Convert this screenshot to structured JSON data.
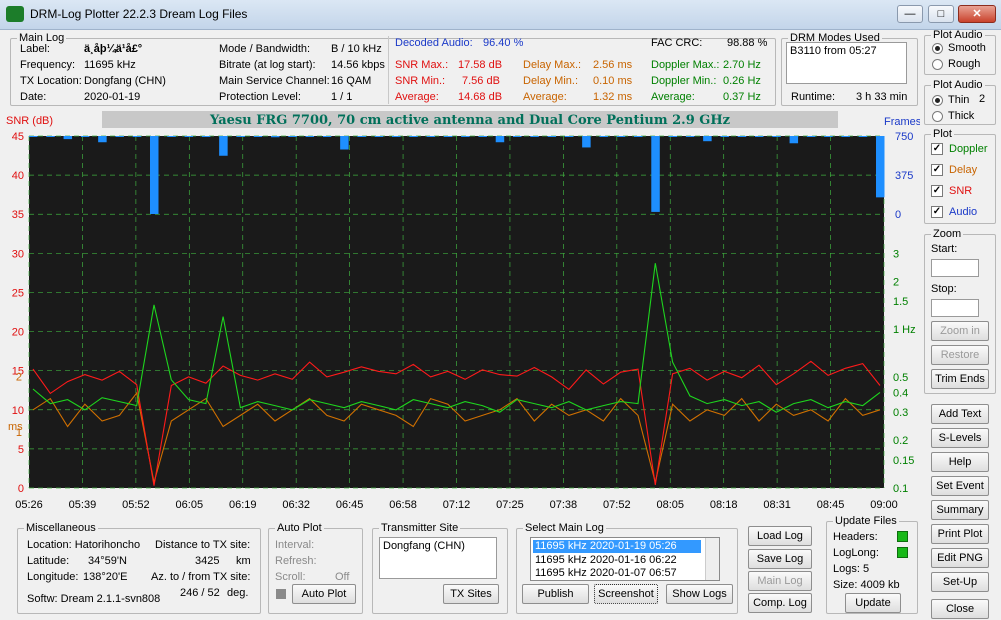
{
  "window": {
    "title": "DRM-Log Plotter 22.2.3    Dream Log Files",
    "min": "—",
    "max": "□",
    "close": "✕"
  },
  "mainlog": {
    "legend": "Main Log",
    "label_k": "Label:",
    "label_v": "ä¸­åþ¼ä¹å£°",
    "freq_k": "Frequency:",
    "freq_v": "11695   kHz",
    "tx_k": "TX Location:",
    "tx_v": "Dongfang (CHN)",
    "date_k": "Date:",
    "date_v": "2020-01-19",
    "mode_k": "Mode / Bandwidth:",
    "mode_v": "B / 10 kHz",
    "bitrate_k": "Bitrate (at log start):",
    "bitrate_v": "14.56 kbps",
    "msc_k": "Main Service Channel:",
    "msc_v": "16  QAM",
    "prot_k": "Protection Level:",
    "prot_v": "1 / 1"
  },
  "stats": {
    "decoded_k": "Decoded Audio:",
    "decoded_v": "96.40 %",
    "fac_k": "FAC  CRC:",
    "fac_v": "98.88 %",
    "snrmax_k": "SNR Max.:",
    "snrmax_v": "17.58  dB",
    "snrmin_k": "SNR Min.:",
    "snrmin_v": "7.56  dB",
    "snravg_k": "Average:",
    "snravg_v": "14.68  dB",
    "dmax_k": "Delay Max.:",
    "dmax_v": "2.56    ms",
    "dmin_k": "Delay Min.:",
    "dmin_v": "0.10    ms",
    "davg_k": "Average:",
    "davg_v": "1.32    ms",
    "dopmax_k": "Doppler Max.:",
    "dopmax_v": "2.70 Hz",
    "dopmin_k": "Doppler Min.:",
    "dopmin_v": "0.26 Hz",
    "dopavg_k": "Average:",
    "dopavg_v": "0.37 Hz"
  },
  "drmmodes": {
    "legend": "DRM Modes Used",
    "entry": "B3110 from 05:27",
    "runtime_k": "Runtime:",
    "runtime_v": "3 h 33 min"
  },
  "plot_audio": {
    "legend": "Plot Audio",
    "smooth": "Smooth",
    "rough": "Rough"
  },
  "plot_audio2": {
    "legend": "Plot Audio",
    "thin": "Thin",
    "thick": "Thick",
    "value": "2"
  },
  "plot_opts": {
    "legend": "Plot",
    "doppler": "Doppler",
    "delay": "Delay",
    "snr": "SNR",
    "audio": "Audio",
    "check": "✓"
  },
  "zoom": {
    "legend": "Zoom",
    "start": "Start:",
    "stop": "Stop:",
    "zoomin": "Zoom in",
    "restore": "Restore",
    "trim": "Trim Ends"
  },
  "rightbtns": {
    "addtext": "Add Text",
    "slevels": "S-Levels",
    "help": "Help",
    "setevent": "Set Event",
    "summary": "Summary",
    "printplot": "Print Plot",
    "editpng": "Edit PNG",
    "setup": "Set-Up",
    "close": "Close"
  },
  "misc": {
    "legend": "Miscellaneous",
    "loc": "Location: Hatorihoncho",
    "dist_k": "Distance to TX site:",
    "lat_k": "Latitude:",
    "lat_v": "34°59'N",
    "dist_v": "3425",
    "lon_k": "Longitude:",
    "lon_v": "138°20'E",
    "km": "km",
    "az_k": "Az. to / from TX site:",
    "az_v": "246 / 52",
    "deg": "deg.",
    "softw": "Softw: Dream 2.1.1-svn808"
  },
  "autoplot": {
    "legend": "Auto Plot",
    "interval": "Interval:",
    "refresh": "Refresh:",
    "scroll": "Scroll:",
    "scroll_v": "Off",
    "btn": "Auto Plot"
  },
  "txsite": {
    "legend": "Transmitter Site",
    "entry": "Dongfang (CHN)",
    "btn": "TX Sites"
  },
  "selectlog": {
    "legend": "Select Main Log",
    "rows": [
      "11695 kHz  2020-01-19   05:26",
      "11695 kHz  2020-01-16   06:22",
      "11695 kHz  2020-01-07   06:57"
    ],
    "publish": "Publish",
    "screenshot": "Screenshot",
    "showlogs": "Show Logs"
  },
  "logbtns": {
    "load": "Load Log",
    "save": "Save Log",
    "main": "Main Log",
    "comp": "Comp. Log"
  },
  "update": {
    "legend": "Update Files",
    "headers": "Headers:",
    "loglong": "LogLong:",
    "logs": "Logs: 5",
    "size": "Size:   4009 kb",
    "btn": "Update"
  },
  "chart_data": {
    "type": "line",
    "title": "Yaesu FRG 7700, 70 cm active antenna and Dual Core Pentium 2.9 GHz",
    "left_axis_label": "SNR (dB)",
    "left_ticks": [
      "45",
      "40",
      "35",
      "30",
      "25",
      "20",
      "15",
      "10",
      "5",
      "0"
    ],
    "delay_axis_label": "ms",
    "delay_ticks": [
      "2",
      "1"
    ],
    "right_axis_label": "Frames",
    "frames_ticks": [
      "750",
      "375",
      "0"
    ],
    "doppler_ticks": [
      "3",
      "2",
      "1.5",
      "1 Hz",
      "0.5",
      "0.4",
      "0.3",
      "0.2",
      "0.15",
      "0.1"
    ],
    "x_ticks": [
      "05:26",
      "05:39",
      "05:52",
      "06:05",
      "06:19",
      "06:32",
      "06:45",
      "06:58",
      "07:12",
      "07:25",
      "07:38",
      "07:52",
      "08:05",
      "08:18",
      "08:31",
      "08:45",
      "09:00"
    ],
    "ylim": [
      0,
      45
    ],
    "grid": true,
    "colors": {
      "snr": "#ff1a1a",
      "delay": "#d07000",
      "doppler": "#1ed51e",
      "audio": "#1e8fff",
      "grid": "#3fae3f",
      "bg": "#1a1a1a"
    },
    "series": [
      {
        "name": "SNR",
        "y": [
          15.2,
          12.1,
          13.6,
          14.5,
          13.8,
          14.9,
          13.2,
          0.3,
          13.1,
          14.2,
          13.4,
          15.6,
          14.4,
          13.8,
          14.6,
          13.9,
          16.1,
          14.2,
          14.8,
          15.5,
          14.9,
          14.6,
          15.8,
          14.2,
          14.9,
          13.9,
          15.1,
          14.5,
          14.3,
          15.4,
          14.2,
          12.6,
          15.1,
          13.3,
          14.8,
          15.2,
          0.4,
          14.6,
          15.3,
          13.8,
          14.9,
          14.1,
          15.7,
          13.2,
          14.6,
          16.2,
          14.4,
          15.3,
          15.9,
          13.1
        ]
      },
      {
        "name": "Delay",
        "y": [
          1.4,
          1.6,
          1.1,
          1.5,
          1.2,
          1.3,
          1.7,
          0.1,
          1.2,
          1.4,
          1.6,
          1.1,
          1.3,
          1.5,
          1.2,
          1.4,
          1.6,
          1.3,
          1.2,
          1.5,
          1.4,
          1.3,
          1.1,
          1.6,
          1.5,
          1.2,
          1.3,
          1.4,
          1.6,
          1.2,
          1.5,
          1.3,
          1.4,
          1.2,
          1.6,
          1.3,
          0.1,
          1.5,
          1.2,
          1.4,
          1.3,
          1.6,
          1.2,
          1.5,
          1.3,
          1.4,
          1.2,
          1.6,
          1.3,
          1.4
        ]
      },
      {
        "name": "Doppler",
        "y": [
          0.42,
          0.34,
          0.36,
          0.31,
          0.37,
          0.35,
          0.33,
          1.42,
          0.48,
          0.36,
          0.34,
          1.2,
          0.32,
          0.35,
          0.33,
          0.31,
          0.36,
          0.34,
          0.32,
          0.35,
          0.33,
          0.31,
          0.36,
          0.34,
          0.32,
          0.35,
          0.33,
          0.3,
          0.36,
          0.34,
          0.32,
          0.35,
          0.31,
          0.33,
          0.35,
          0.34,
          2.6,
          0.62,
          0.38,
          0.34,
          0.36,
          0.33,
          0.35,
          0.3,
          0.34,
          0.36,
          0.32,
          0.35,
          0.33,
          0.4
        ]
      },
      {
        "name": "Audio",
        "y": [
          748,
          745,
          720,
          748,
          690,
          748,
          746,
          0,
          748,
          744,
          748,
          560,
          748,
          748,
          738,
          748,
          745,
          748,
          620,
          748,
          746,
          748,
          748,
          742,
          748,
          745,
          748,
          690,
          748,
          748,
          747,
          748,
          640,
          748,
          748,
          745,
          20,
          748,
          748,
          700,
          748,
          746,
          748,
          748,
          680,
          748,
          745,
          748,
          748,
          160
        ]
      }
    ]
  }
}
